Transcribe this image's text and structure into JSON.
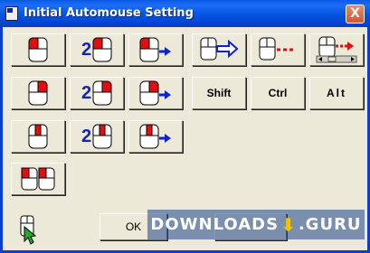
{
  "window": {
    "title": "Initial Automouse Setting",
    "close_glyph": "X"
  },
  "colors": {
    "title_bar": "#0453df",
    "face": "#ece9d8",
    "mouse_button": "#e01010",
    "arrow": "#1020d0",
    "close": "#d5532f"
  },
  "grid": {
    "rows": [
      {
        "single": "mouse-left-click-icon",
        "double_label": "2",
        "drag": "mouse-left-drag-icon"
      },
      {
        "single": "mouse-right-click-icon",
        "double_label": "2",
        "drag": "mouse-right-drag-icon"
      },
      {
        "single": "mouse-middle-click-icon",
        "double_label": "2",
        "drag": "mouse-middle-drag-icon"
      }
    ],
    "extra": "two-mice-icon"
  },
  "right_panel": {
    "tools": [
      "mouse-arrow-icon",
      "mouse-dotted-line-icon",
      "mouse-scroll-icon"
    ],
    "keys": {
      "shift": "Shift",
      "ctrl": "Ctrl",
      "alt": "Alt"
    }
  },
  "footer": {
    "ok_label": "OK",
    "icon": "mouse-cursor-icon"
  },
  "watermark": {
    "text_a": "DOWNLOADS",
    "text_b": ".GURU"
  }
}
